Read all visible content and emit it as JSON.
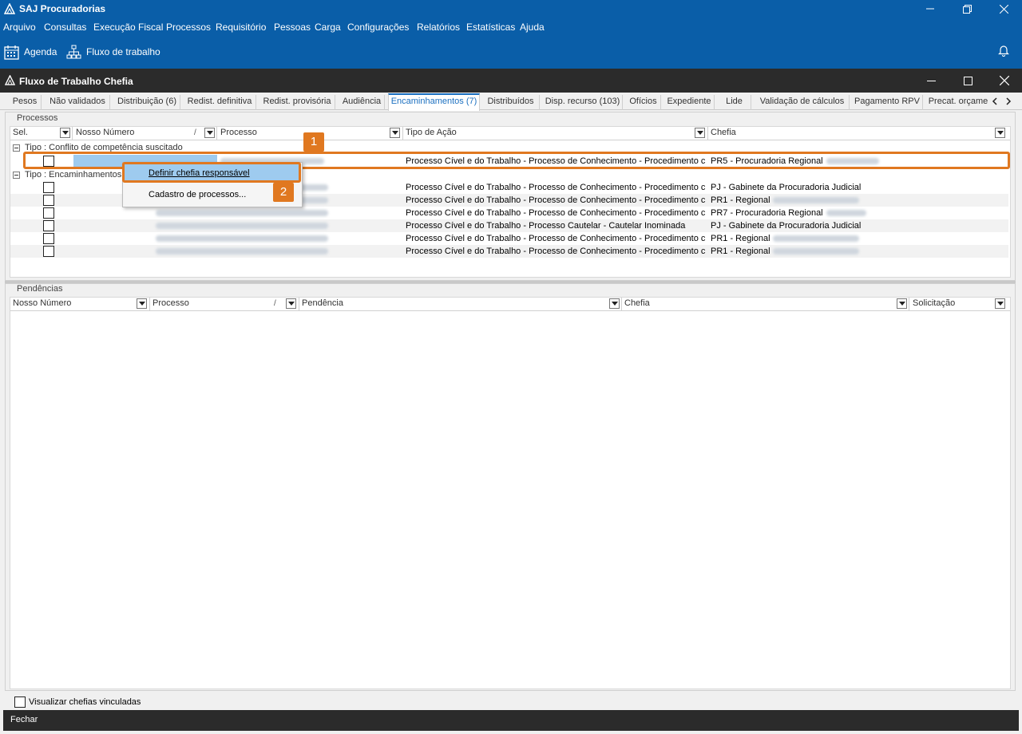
{
  "app": {
    "title": "SAJ Procuradorias"
  },
  "menu": [
    "Arquivo",
    "Consultas",
    "Execução Fiscal",
    "Processos",
    "Requisitório",
    "Pessoas",
    "Carga",
    "Configurações",
    "Relatórios",
    "Estatísticas",
    "Ajuda"
  ],
  "toolbar": {
    "agenda": "Agenda",
    "fluxo": "Fluxo de trabalho"
  },
  "window": {
    "title": "Fluxo de Trabalho Chefia"
  },
  "tabs": [
    "Pesos",
    "Não validados",
    "Distribuição (6)",
    "Redist. definitiva",
    "Redist. provisória",
    "Audiência",
    "Encaminhamentos (7)",
    "Distribuídos",
    "Disp. recurso (103)",
    "Ofícios",
    "Expediente",
    "Lide",
    "Validação de cálculos",
    "Pagamento RPV",
    "Precat. orçame"
  ],
  "active_tab": "Encaminhamentos (7)",
  "processos": {
    "title": "Processos",
    "columns": [
      "Sel.",
      "Nosso Número",
      "Processo",
      "Tipo de Ação",
      "Chefia"
    ],
    "group1": "Tipo : Conflito de competência suscitado",
    "group2": "Tipo : Encaminhamentos",
    "rows": [
      {
        "tipo": "Processo Cível e do Trabalho - Processo de Conhecimento - Procedimento c",
        "chefia": "PR5 - Procuradoria Regional"
      },
      {
        "tipo": "Processo Cível e do Trabalho - Processo de Conhecimento - Procedimento c",
        "chefia": "PJ - Gabinete da Procuradoria Judicial"
      },
      {
        "tipo": "Processo Cível e do Trabalho - Processo de Conhecimento - Procedimento c",
        "chefia": "PR1 - Regional"
      },
      {
        "tipo": "Processo Cível e do Trabalho - Processo de Conhecimento - Procedimento c",
        "chefia": "PR7 - Procuradoria Regional"
      },
      {
        "tipo": "Processo Cível e do Trabalho - Processo Cautelar - Cautelar Inominada",
        "chefia": "PJ - Gabinete da Procuradoria Judicial"
      },
      {
        "tipo": "Processo Cível e do Trabalho - Processo de Conhecimento - Procedimento c",
        "chefia": "PR1 - Regional"
      },
      {
        "tipo": "Processo Cível e do Trabalho - Processo de Conhecimento - Procedimento c",
        "chefia": "PR1 - Regional"
      }
    ]
  },
  "context_menu": {
    "define": "Definir chefia responsável",
    "cadastro": "Cadastro de processos..."
  },
  "callouts": [
    "1",
    "2"
  ],
  "pendencias": {
    "title": "Pendências",
    "columns": [
      "Nosso Número",
      "Processo",
      "Pendência",
      "Chefia",
      "Solicitação"
    ]
  },
  "footer": {
    "checkbox": "Visualizar chefias vinculadas",
    "close": "Fechar"
  },
  "colors": {
    "titlebar": "#0a5ea8",
    "child_titlebar": "#2b2b2b",
    "highlight": "#e07820",
    "selection": "#9ecbef"
  }
}
